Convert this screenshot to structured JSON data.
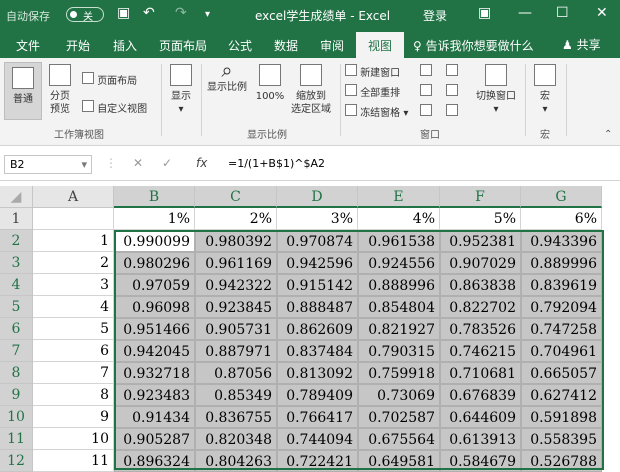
{
  "title": {
    "autosave": "自动保存",
    "toggle": "关",
    "window_title": "excel学生成绩单 - Excel",
    "login": "登录"
  },
  "tabs": [
    "文件",
    "开始",
    "插入",
    "页面布局",
    "公式",
    "数据",
    "审阅",
    "视图"
  ],
  "tellme": "告诉我你想要做什么",
  "share": "共享",
  "ribbon": {
    "normal": "普通",
    "pagebreak1": "分页",
    "pagebreak2": "预览",
    "pagelayout": "页面布局",
    "custom": "自定义视图",
    "wbgroup": "工作簿视图",
    "show": "显示",
    "zoom": "显示比例",
    "z100": "100%",
    "zsel1": "缩放到",
    "zsel2": "选定区域",
    "zoomgroup": "显示比例",
    "newwin": "新建窗口",
    "arrange": "全部重排",
    "freeze": "冻结窗格",
    "winswitch": "切换窗口",
    "wingroup": "窗口",
    "macro": "宏",
    "macrogroup": "宏"
  },
  "formula": {
    "namebox": "B2",
    "fx": "fx",
    "value": "=1/(1+B$1)^$A2"
  },
  "cols": [
    "A",
    "B",
    "C",
    "D",
    "E",
    "F",
    "G"
  ],
  "rows": [
    [
      "",
      "1%",
      "2%",
      "3%",
      "4%",
      "5%",
      "6%"
    ],
    [
      "1",
      "0.990099",
      "0.980392",
      "0.970874",
      "0.961538",
      "0.952381",
      "0.943396"
    ],
    [
      "2",
      "0.980296",
      "0.961169",
      "0.942596",
      "0.924556",
      "0.907029",
      "0.889996"
    ],
    [
      "3",
      "0.97059",
      "0.942322",
      "0.915142",
      "0.888996",
      "0.863838",
      "0.839619"
    ],
    [
      "4",
      "0.96098",
      "0.923845",
      "0.888487",
      "0.854804",
      "0.822702",
      "0.792094"
    ],
    [
      "5",
      "0.951466",
      "0.905731",
      "0.862609",
      "0.821927",
      "0.783526",
      "0.747258"
    ],
    [
      "6",
      "0.942045",
      "0.887971",
      "0.837484",
      "0.790315",
      "0.746215",
      "0.704961"
    ],
    [
      "7",
      "0.932718",
      "0.87056",
      "0.813092",
      "0.759918",
      "0.710681",
      "0.665057"
    ],
    [
      "8",
      "0.923483",
      "0.85349",
      "0.789409",
      "0.73069",
      "0.676839",
      "0.627412"
    ],
    [
      "9",
      "0.91434",
      "0.836755",
      "0.766417",
      "0.702587",
      "0.644609",
      "0.591898"
    ],
    [
      "10",
      "0.905287",
      "0.820348",
      "0.744094",
      "0.675564",
      "0.613913",
      "0.558395"
    ],
    [
      "11",
      "0.896324",
      "0.804263",
      "0.722421",
      "0.649581",
      "0.584679",
      "0.526788"
    ]
  ]
}
